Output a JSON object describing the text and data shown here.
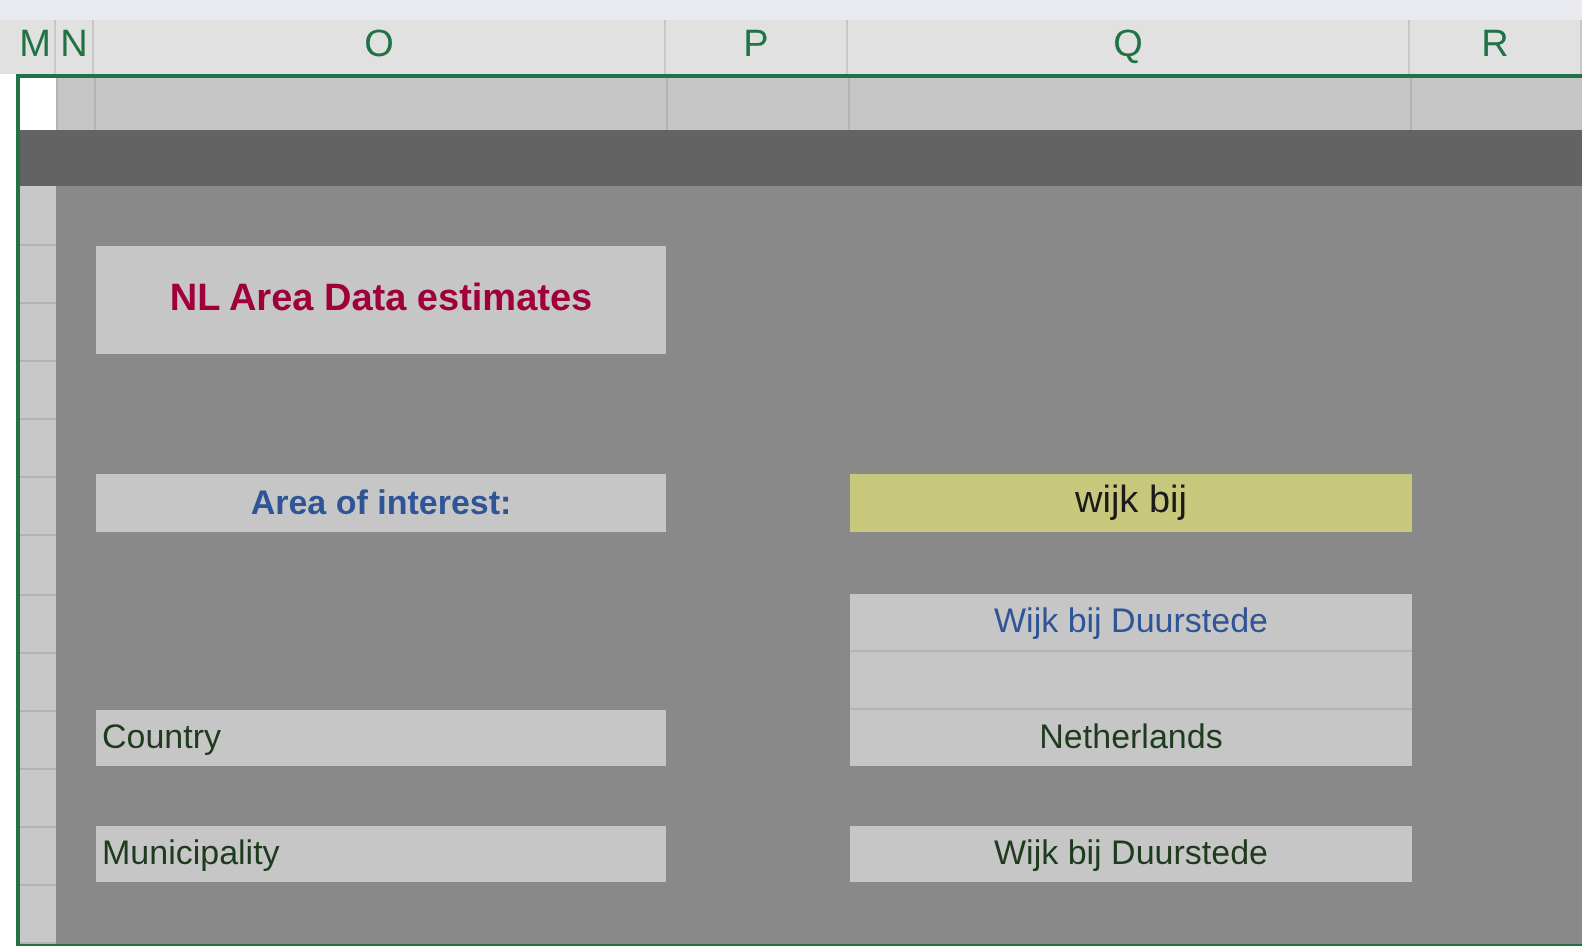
{
  "column_headers": [
    "M",
    "N",
    "O",
    "P",
    "Q",
    "R"
  ],
  "title": "NL Area Data estimates",
  "area_label": "Area of interest:",
  "area_input": {
    "value": "wijk bij"
  },
  "match": "Wijk bij Duurstede",
  "rows": [
    {
      "label": "Country",
      "value": "Netherlands"
    },
    {
      "label": "Municipality",
      "value": "Wijk bij Duurstede"
    }
  ]
}
